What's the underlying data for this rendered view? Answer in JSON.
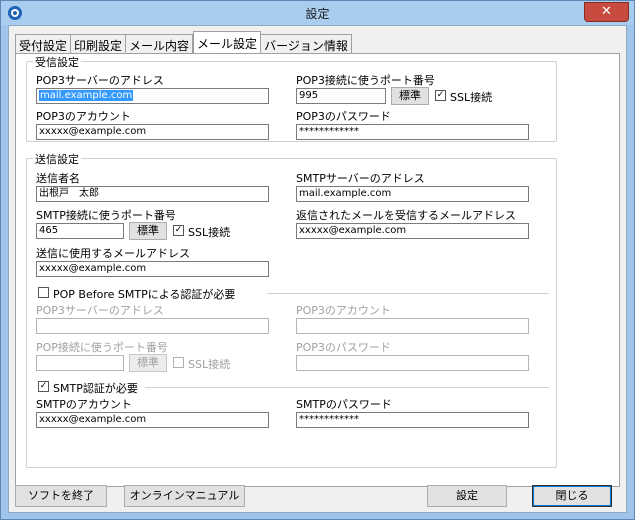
{
  "window": {
    "title": "設定",
    "close": "✕"
  },
  "tabs": [
    "受付設定",
    "印刷設定",
    "メール内容",
    "メール設定",
    "バージョン情報"
  ],
  "receive": {
    "group_title": "受信設定",
    "pop3_server_label": "POP3サーバーのアドレス",
    "pop3_server_value": "mail.example.com",
    "pop3_port_label": "POP3接続に使うポート番号",
    "pop3_port_value": "995",
    "default_button": "標準",
    "ssl_label": "SSL接続",
    "ssl_checked": "✓",
    "account_label": "POP3のアカウント",
    "account_value": "xxxxx@example.com",
    "password_label": "POP3のパスワード",
    "password_value": "************"
  },
  "send": {
    "group_title": "送信設定",
    "sender_label": "送信者名",
    "sender_value": "出根戸　太郎",
    "smtp_server_label": "SMTPサーバーのアドレス",
    "smtp_server_value": "mail.example.com",
    "smtp_port_label": "SMTP接続に使うポート番号",
    "smtp_port_value": "465",
    "default_button": "標準",
    "ssl_label": "SSL接続",
    "ssl_checked": "✓",
    "reply_label": "返信されたメールを受信するメールアドレス",
    "reply_value": "xxxxx@example.com",
    "send_addr_label": "送信に使用するメールアドレス",
    "send_addr_value": "xxxxx@example.com",
    "pbs_label": "POP Before SMTPによる認証が必要",
    "pbs_checked": "",
    "pbs_server_label": "POP3サーバーのアドレス",
    "pbs_account_label": "POP3のアカウント",
    "pbs_port_label": "POP接続に使うポート番号",
    "pbs_default_button": "標準",
    "pbs_ssl_label": "SSL接続",
    "pbs_password_label": "POP3のパスワード",
    "smtp_auth_label": "SMTP認証が必要",
    "smtp_auth_checked": "✓",
    "smtp_account_label": "SMTPのアカウント",
    "smtp_account_value": "xxxxx@example.com",
    "smtp_password_label": "SMTPのパスワード",
    "smtp_password_value": "************"
  },
  "footer": {
    "quit": "ソフトを終了",
    "manual": "オンラインマニュアル",
    "settings": "設定",
    "close": "閉じる"
  }
}
